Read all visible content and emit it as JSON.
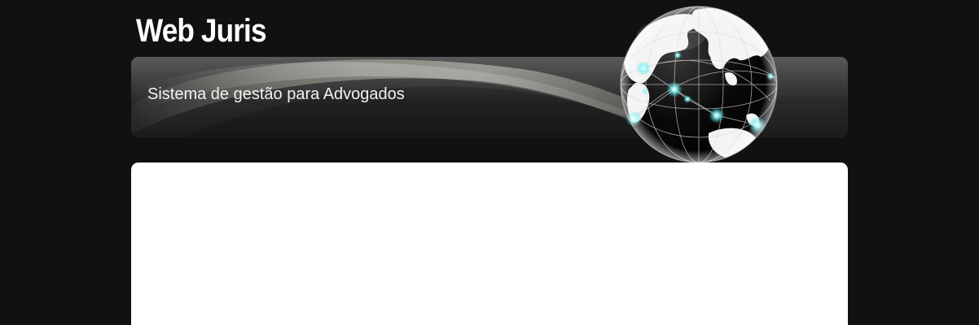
{
  "header": {
    "logo_text": "Web Juris",
    "tagline": "Sistema de gestão para Advogados",
    "globe_icon": "globe-network-icon"
  },
  "colors": {
    "page_background": "#111111",
    "banner_top": "#595959",
    "banner_bottom": "#1b1b1b",
    "network_glow": "#5ff2f2",
    "content_background": "#ffffff"
  }
}
